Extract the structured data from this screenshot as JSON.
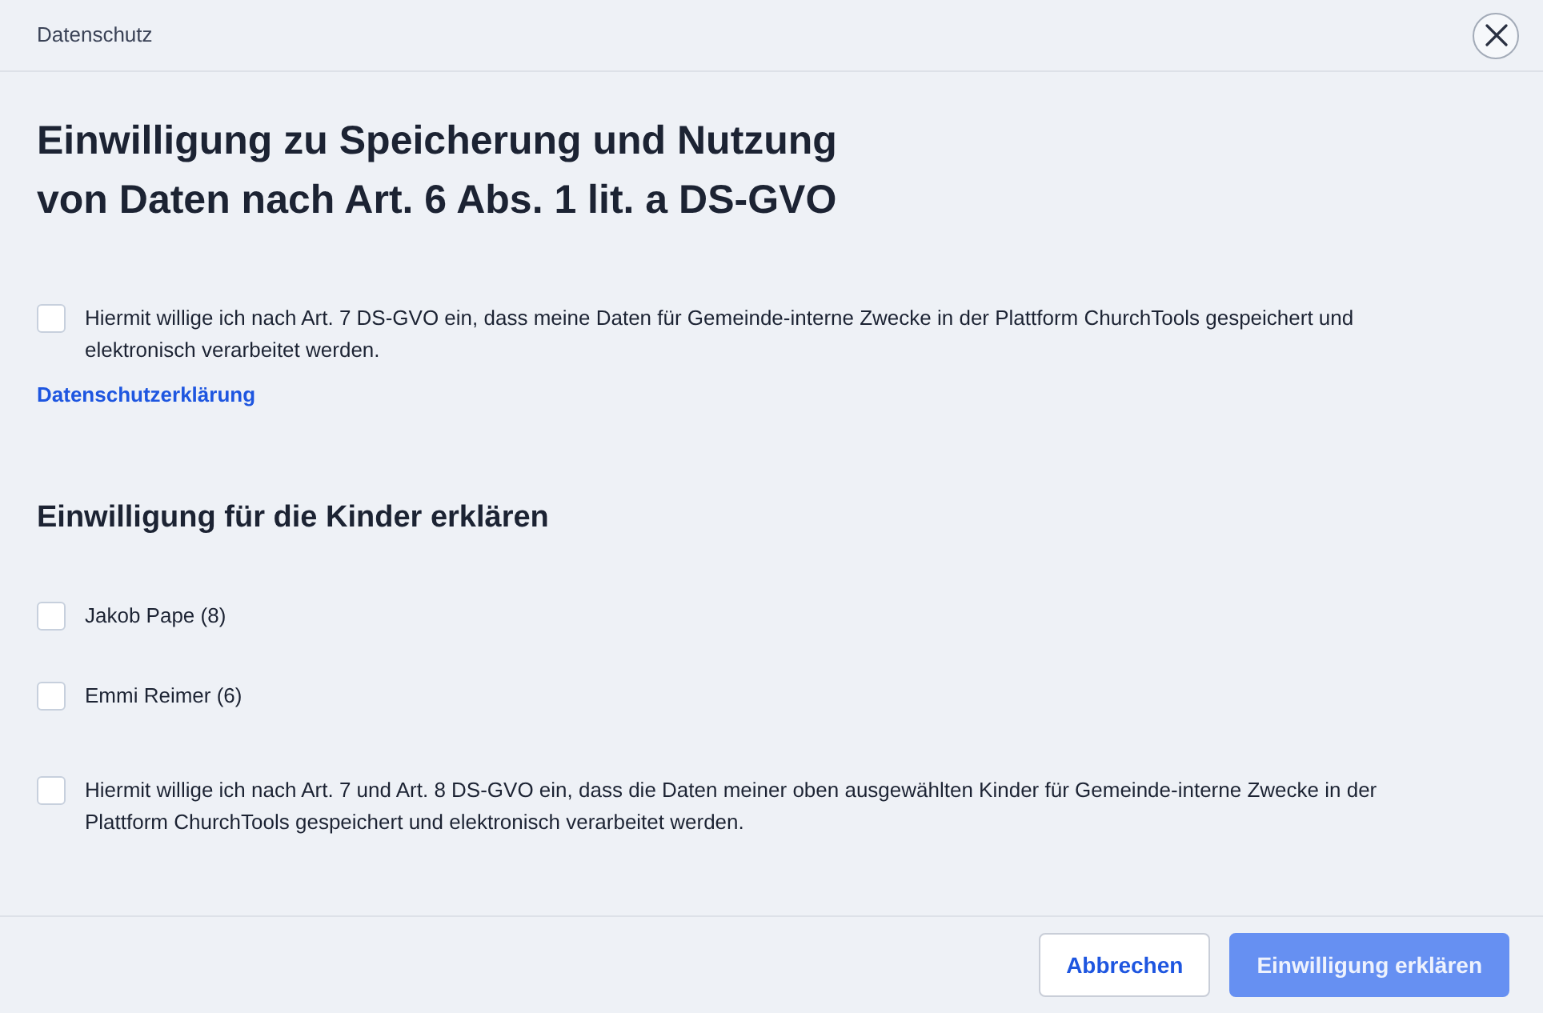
{
  "header": {
    "title": "Datenschutz"
  },
  "heading_lines": [
    "Einwilligung zu Speicherung und Nutzung",
    "von Daten nach Art. 6 Abs. 1 lit. a DS-GVO"
  ],
  "consent": {
    "checked": false,
    "text": "Hiermit willige ich nach Art. 7 DS-GVO ein, dass meine Daten für Gemeinde-interne Zwecke in der Plattform ChurchTools gespeichert und elektronisch verarbeitet werden."
  },
  "privacy_link": "Datenschutzerklärung",
  "children_section": {
    "heading": "Einwilligung für die Kinder erklären",
    "children": [
      {
        "label": "Jakob Pape (8)",
        "checked": false
      },
      {
        "label": "Emmi Reimer (6)",
        "checked": false
      }
    ],
    "consent": {
      "checked": false,
      "text": "Hiermit willige ich nach Art. 7 und Art. 8 DS-GVO ein, dass die Daten meiner oben ausgewählten Kinder für Gemeinde-interne Zwecke in der Plattform ChurchTools gespeichert und elektronisch verarbeitet werden."
    }
  },
  "footer": {
    "buttons": [
      {
        "label": "Abbrechen",
        "kind": "secondary",
        "disabled": false
      },
      {
        "label": "Einwilligung erklären",
        "kind": "primary",
        "disabled": true
      }
    ]
  }
}
